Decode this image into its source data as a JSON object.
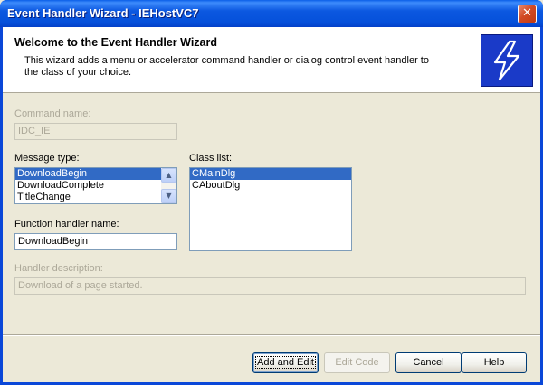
{
  "window": {
    "title": "Event Handler Wizard - IEHostVC7",
    "close_glyph": "✕"
  },
  "header": {
    "title": "Welcome to the Event Handler Wizard",
    "description": "This wizard adds a menu or accelerator command handler or dialog control event handler to the class of your choice."
  },
  "command_name": {
    "label": "Command name:",
    "value": "IDC_IE"
  },
  "message_type": {
    "label": "Message type:",
    "items": [
      "DownloadBegin",
      "DownloadComplete",
      "TitleChange"
    ],
    "selected": "DownloadBegin"
  },
  "class_list": {
    "label": "Class list:",
    "items": [
      "CMainDlg",
      "CAboutDlg"
    ],
    "selected": "CMainDlg"
  },
  "function_handler": {
    "label": "Function handler name:",
    "value": "DownloadBegin"
  },
  "handler_description": {
    "label": "Handler description:",
    "value": "Download of a page started."
  },
  "buttons": {
    "add_and_edit": "Add and Edit",
    "edit_code": "Edit Code",
    "cancel": "Cancel",
    "help": "Help"
  },
  "icons": {
    "wizard": "lightning-bolt-icon",
    "scroll_up": "▲",
    "scroll_down": "▼"
  },
  "colors": {
    "title_bar": "#0A5FE8",
    "selection": "#316AC5",
    "wizard_icon_bg": "#1A3AC8"
  }
}
